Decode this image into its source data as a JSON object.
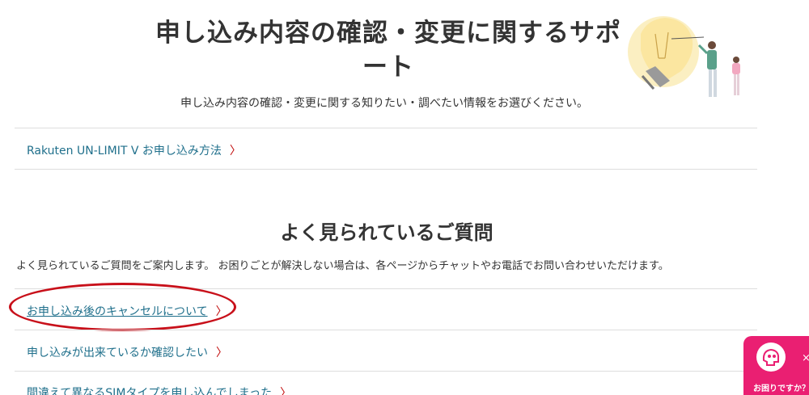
{
  "hero": {
    "title": "申し込み内容の確認・変更に関するサポート",
    "subtitle": "申し込み内容の確認・変更に関する知りたい・調べたい情報をお選びください。"
  },
  "top_links": [
    {
      "label": "Rakuten UN-LIMIT V お申し込み方法"
    }
  ],
  "faq": {
    "heading": "よく見られているご質問",
    "description": "よく見られているご質問をご案内します。 お困りごとが解決しない場合は、各ページからチャットやお電話でお問い合わせいただけます。",
    "items": [
      {
        "label": "お申し込み後のキャンセルについて"
      },
      {
        "label": "申し込みが出来ているか確認したい"
      },
      {
        "label": "間違えて異なるSIMタイプを申し込んでしまった"
      }
    ]
  },
  "help_widget": {
    "label": "お困りですか？",
    "close": "×",
    "icon": "robot-head-icon"
  },
  "chevron_glyph": "〉",
  "colors": {
    "link": "#1f6f8b",
    "chevron": "#bf0000",
    "annotation": "#c8101a",
    "help_widget_bg": "#ea1f72",
    "divider": "#dddddd"
  }
}
